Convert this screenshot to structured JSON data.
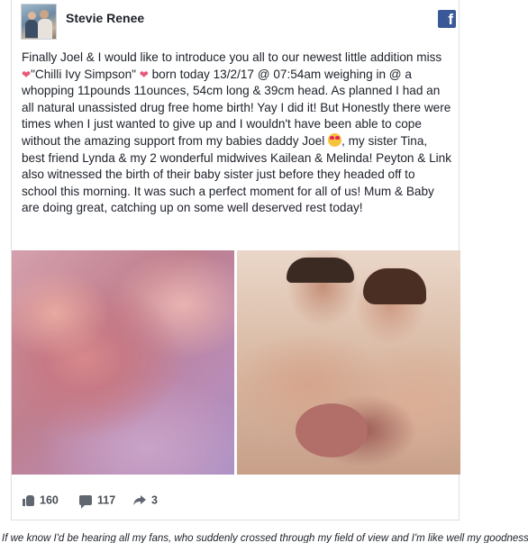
{
  "post": {
    "author": "Stevie Renee",
    "brand_icon": "facebook-icon",
    "text_part1": "Finally Joel & I would like to introduce you all to our newest little addition miss ",
    "heart_1": "❤",
    "text_part2": "\"Chilli Ivy Simpson\" ",
    "heart_2": "❤",
    "text_part3": " born today 13/2/17 @ 07:54am weighing in @ a whopping 11pounds 11ounces, 54cm long & 39cm head. As planned I had an all natural unassisted drug free home birth! Yay I did it! But Honestly there were times when I just wanted to give up and I wouldn't have been able to cope without the amazing support from my babies daddy Joel ",
    "text_part4": ", my sister Tina, best friend Lynda & my 2 wonderful midwives Kailean & Melinda! Peyton & Link also witnessed the birth of their baby sister just before they headed off to school this morning. It was such a perfect moment for all of us! Mum & Baby are doing great, catching up on some well deserved rest today!",
    "emoji": "heart-eyes-emoji"
  },
  "actions": {
    "likes": "160",
    "comments": "117",
    "shares": "3"
  },
  "footer_strip": "If we know I'd be hearing all my fans, who suddenly crossed through my field of view and I'm like well my goodness I did it thank you!!!"
}
